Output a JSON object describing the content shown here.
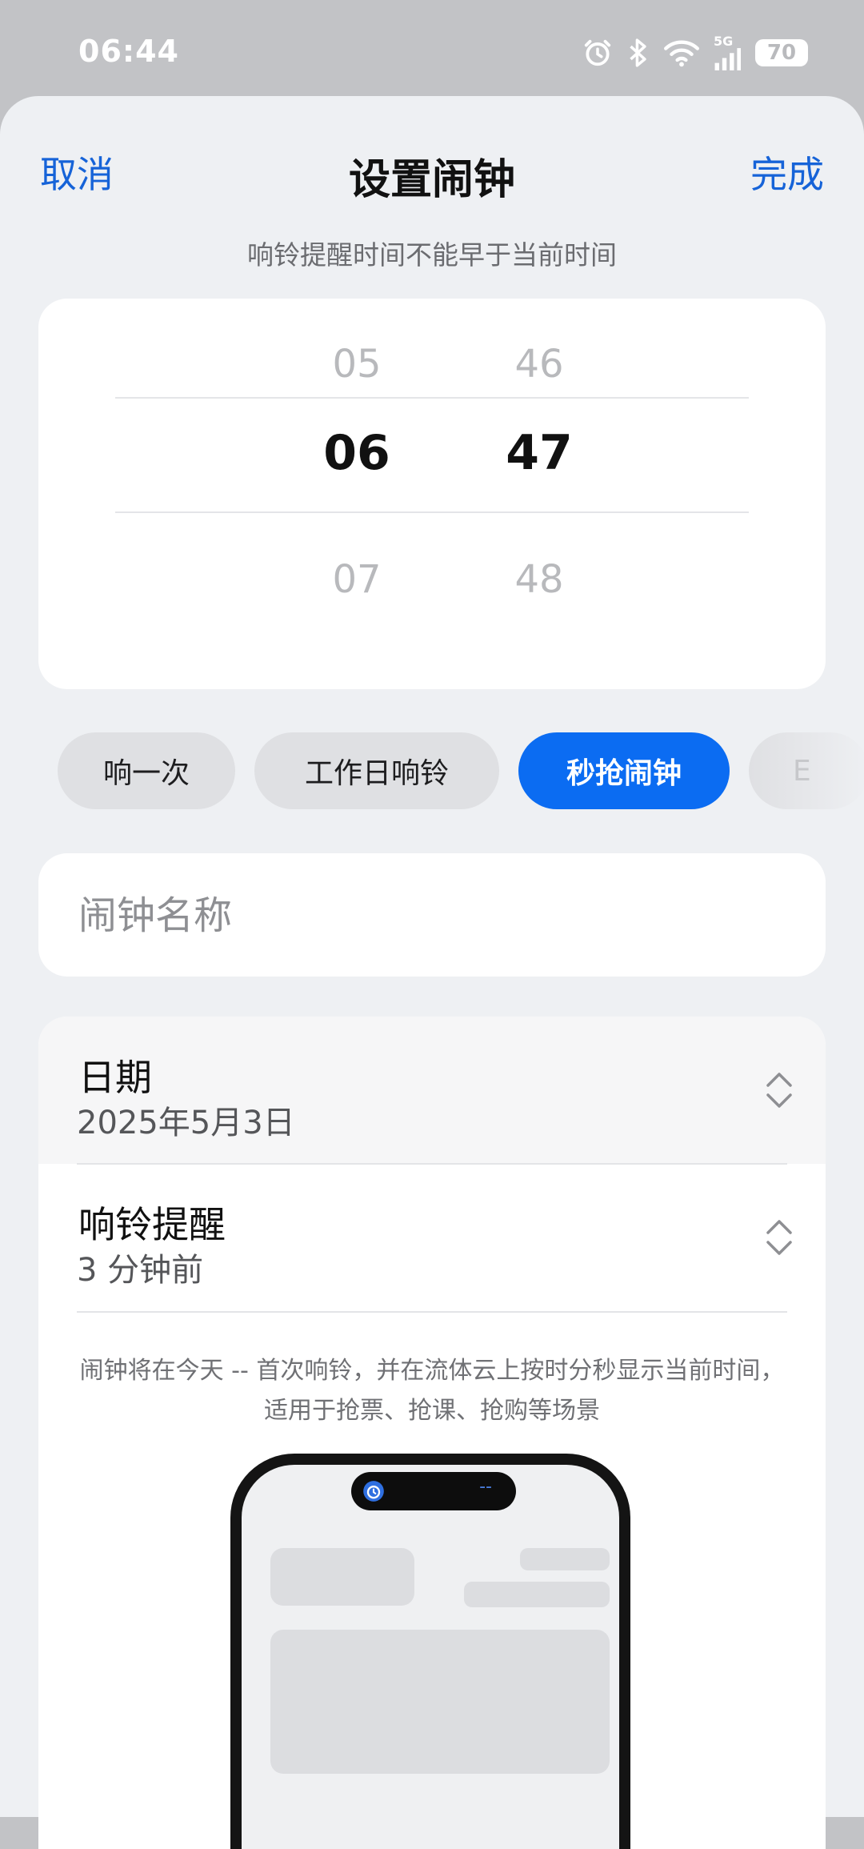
{
  "status_bar": {
    "time": "06:44",
    "network": "5G",
    "battery": "70",
    "icons": [
      "alarm-icon",
      "bluetooth-icon",
      "wifi-icon",
      "signal-icon",
      "battery-icon"
    ]
  },
  "nav": {
    "cancel_label": "取消",
    "title": "设置闹钟",
    "done_label": "完成"
  },
  "subtitle": "响铃提醒时间不能早于当前时间",
  "time_picker": {
    "hours": [
      "05",
      "06",
      "07"
    ],
    "minutes": [
      "46",
      "47",
      "48"
    ],
    "selected_hour": "06",
    "selected_minute": "47"
  },
  "repeat_chips": [
    {
      "label": "响一次",
      "selected": false
    },
    {
      "label": "工作日响铃",
      "selected": false
    },
    {
      "label": "秒抢闹钟",
      "selected": true
    },
    {
      "label": "E",
      "selected": false
    }
  ],
  "alarm_name": {
    "placeholder": "闹钟名称",
    "value": ""
  },
  "settings": {
    "date": {
      "label": "日期",
      "value": "2025年5月3日"
    },
    "reminder": {
      "label": "响铃提醒",
      "value": "3 分钟前"
    }
  },
  "description": "闹钟将在今天 -- 首次响铃，并在流体云上按时分秒显示当前时间，适用于抢票、抢课、抢购等场景",
  "preview": {
    "island_text": "--"
  },
  "colors": {
    "accent": "#1663d8",
    "chip_active": "#0b6cf2",
    "background": "#eef0f3"
  }
}
